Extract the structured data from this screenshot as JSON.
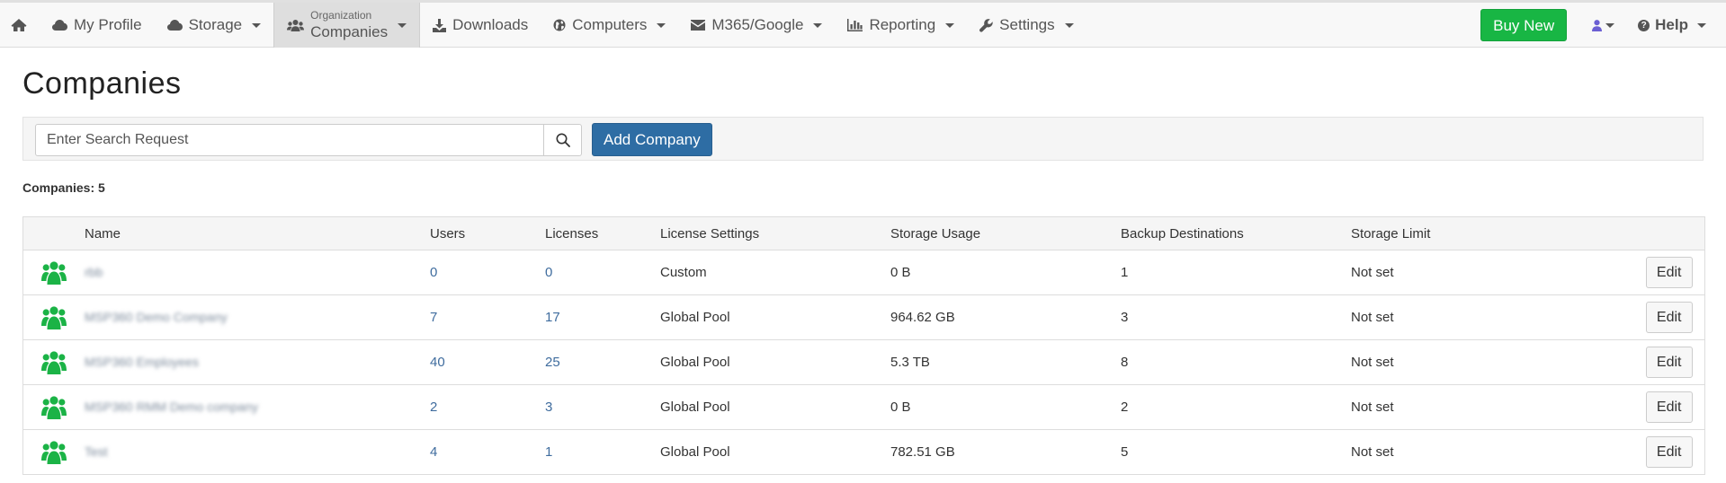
{
  "nav": {
    "items": [
      {
        "id": "home",
        "icon": "home-icon",
        "label": ""
      },
      {
        "id": "my-profile",
        "icon": "cloud-icon",
        "label": "My Profile"
      },
      {
        "id": "storage",
        "icon": "cloud-icon",
        "label": "Storage",
        "dropdown": true
      },
      {
        "id": "organization",
        "icon": "users-icon",
        "small": "Organization",
        "label": "Companies",
        "dropdown": true,
        "active": true
      },
      {
        "id": "downloads",
        "icon": "download-icon",
        "label": "Downloads"
      },
      {
        "id": "computers",
        "icon": "globe-icon",
        "label": "Computers",
        "dropdown": true
      },
      {
        "id": "m365-google",
        "icon": "envelope-icon",
        "label": "M365/Google",
        "dropdown": true
      },
      {
        "id": "reporting",
        "icon": "bar-chart-icon",
        "label": "Reporting",
        "dropdown": true
      },
      {
        "id": "settings",
        "icon": "wrench-icon",
        "label": "Settings",
        "dropdown": true
      }
    ],
    "buy_new": "Buy New",
    "help": "Help",
    "user_icon_color": "#6b5fd3"
  },
  "page": {
    "title": "Companies",
    "search_placeholder": "Enter Search Request",
    "add_company": "Add Company",
    "count_text": "Companies: 5"
  },
  "table": {
    "columns": [
      "",
      "Name",
      "Users",
      "Licenses",
      "License Settings",
      "Storage Usage",
      "Backup Destinations",
      "Storage Limit",
      ""
    ],
    "edit_label": "Edit",
    "icon_color": "#1bb346",
    "rows": [
      {
        "name": "rbb",
        "users": "0",
        "licenses": "0",
        "license_settings": "Custom",
        "storage_usage": "0 B",
        "backup_destinations": "1",
        "storage_limit": "Not set"
      },
      {
        "name": "MSP360 Demo Company",
        "users": "7",
        "licenses": "17",
        "license_settings": "Global Pool",
        "storage_usage": "964.62 GB",
        "backup_destinations": "3",
        "storage_limit": "Not set"
      },
      {
        "name": "MSP360 Employees",
        "users": "40",
        "licenses": "25",
        "license_settings": "Global Pool",
        "storage_usage": "5.3 TB",
        "backup_destinations": "8",
        "storage_limit": "Not set"
      },
      {
        "name": "MSP360 RMM Demo company",
        "users": "2",
        "licenses": "3",
        "license_settings": "Global Pool",
        "storage_usage": "0 B",
        "backup_destinations": "2",
        "storage_limit": "Not set"
      },
      {
        "name": "Test",
        "users": "4",
        "licenses": "1",
        "license_settings": "Global Pool",
        "storage_usage": "782.51 GB",
        "backup_destinations": "5",
        "storage_limit": "Not set"
      }
    ]
  }
}
